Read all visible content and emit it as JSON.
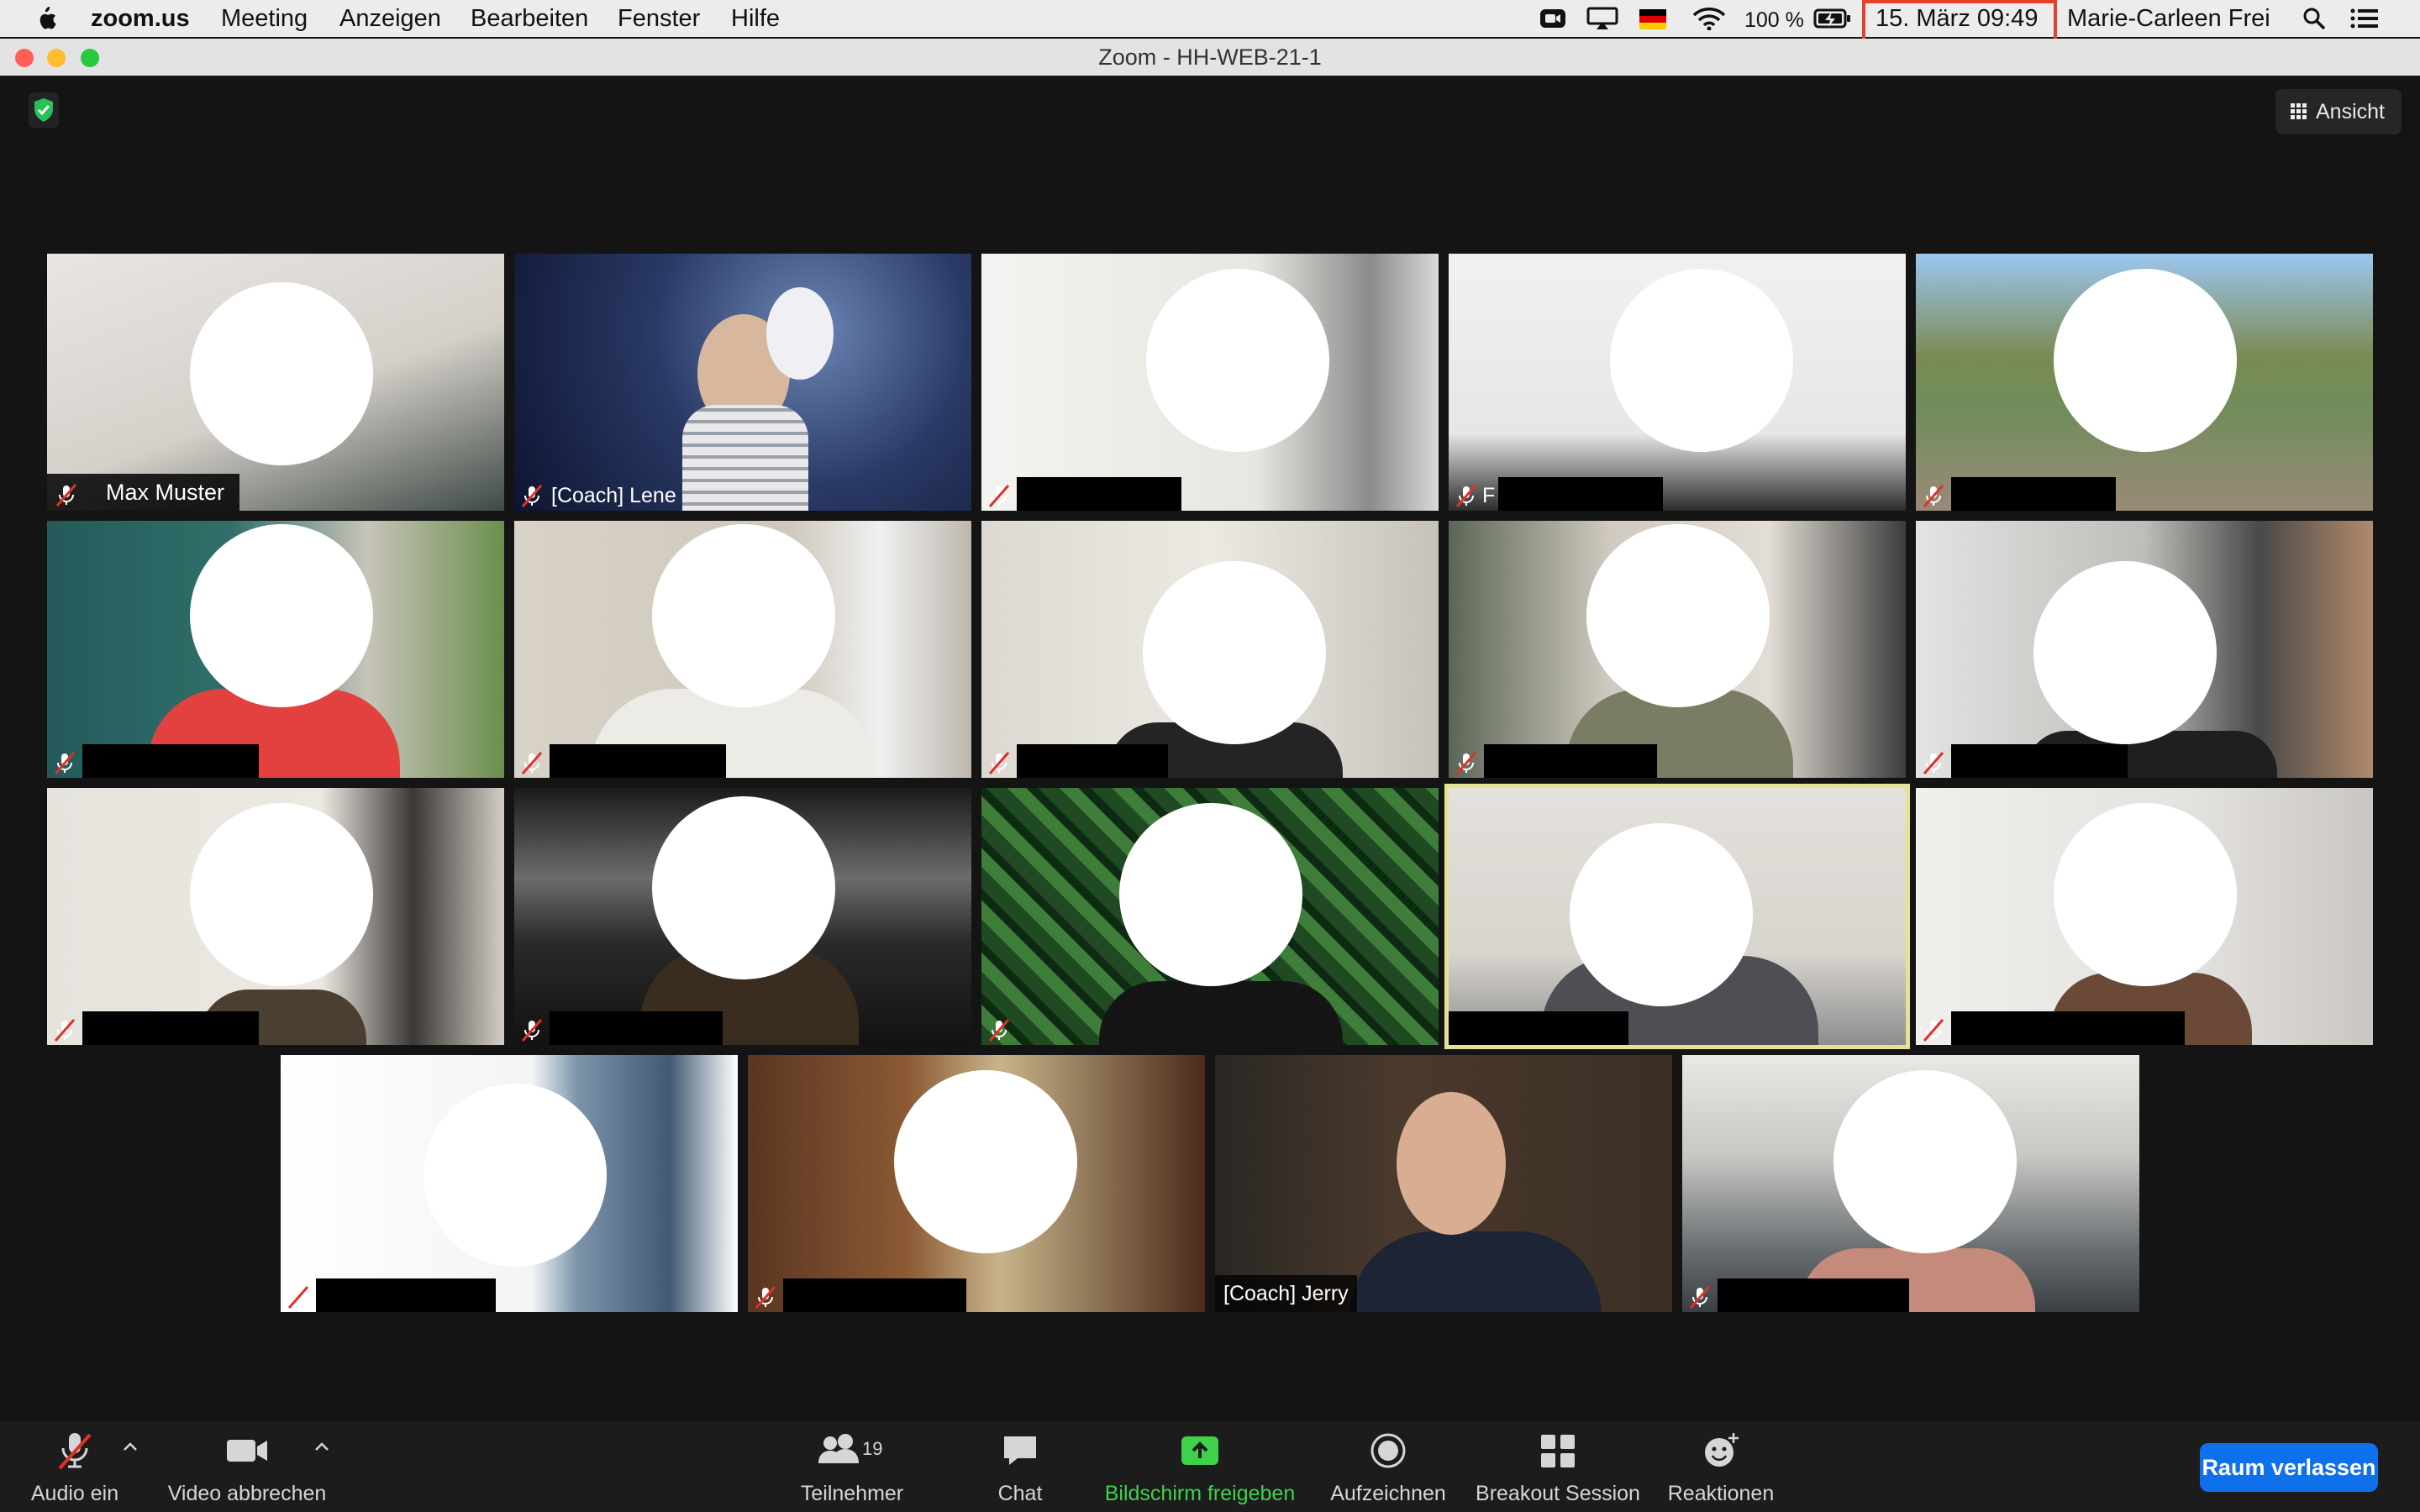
{
  "menubar": {
    "app_name": "zoom.us",
    "menus": [
      "Meeting",
      "Anzeigen",
      "Bearbeiten",
      "Fenster",
      "Hilfe"
    ],
    "battery": "100 %",
    "datetime": "15. März  09:49",
    "user": "Marie-Carleen Frei"
  },
  "window": {
    "title": "Zoom - HH-WEB-21-1"
  },
  "top_right": {
    "view_label": "Ansicht"
  },
  "tiles": [
    {
      "name": "Max Muster"
    },
    {
      "name": "[Coach] Lene"
    },
    {
      "name": ""
    },
    {
      "name": "F"
    },
    {
      "name": ""
    },
    {
      "name": ""
    },
    {
      "name": ""
    },
    {
      "name": ""
    },
    {
      "name": ""
    },
    {
      "name": ""
    },
    {
      "name": ""
    },
    {
      "name": ""
    },
    {
      "name": ""
    },
    {
      "name": ""
    },
    {
      "name": ""
    },
    {
      "name": ""
    },
    {
      "name": ""
    },
    {
      "name": "[Coach] Jerry"
    },
    {
      "name": ""
    }
  ],
  "toolbar": {
    "audio": "Audio ein",
    "video": "Video abbrechen",
    "participants": "Teilnehmer",
    "participants_count": "19",
    "chat": "Chat",
    "share": "Bildschirm freigeben",
    "record": "Aufzeichnen",
    "breakout": "Breakout Session",
    "reactions": "Reaktionen",
    "leave": "Raum verlassen"
  },
  "colors": {
    "share_green": "#3fd14a",
    "leave_blue": "#0e71eb",
    "active_speaker": "#e6e295",
    "clock_highlight": "#e0402c"
  }
}
